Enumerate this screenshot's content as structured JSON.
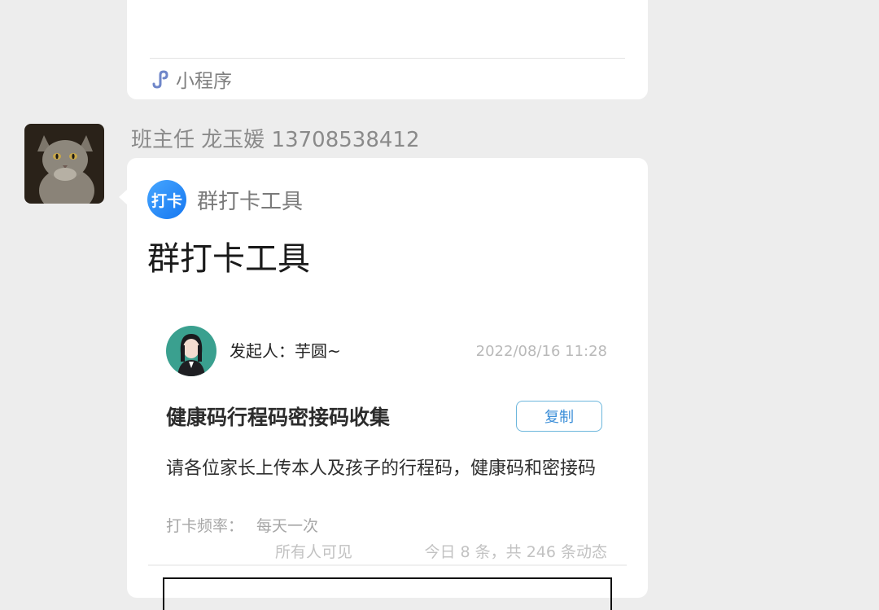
{
  "previous_message": {
    "mini_program_label": "小程序",
    "mini_program_icon": "mini-program-link-icon"
  },
  "message": {
    "sender": "班主任 龙玉媛 13708538412",
    "avatar": "cat-avatar",
    "card": {
      "app_icon_text": "打卡",
      "app_name": "群打卡工具",
      "title": "群打卡工具",
      "initiator": "发起人：芋圆~",
      "initiator_avatar": "woman-avatar",
      "timestamp": "2022/08/16 11:28",
      "task_title": "健康码行程码密接码收集",
      "copy_label": "复制",
      "description": "请各位家长上传本人及孩子的行程码，健康码和密接码",
      "frequency_label": "打卡频率：",
      "frequency_value": "每天一次",
      "visibility": "所有人可见",
      "stats": "今日 8 条，共 246 条动态"
    }
  },
  "colors": {
    "background": "#ededed",
    "card": "#ffffff",
    "accent_blue": "#1677f0",
    "copy_border": "#6cb6dc"
  }
}
